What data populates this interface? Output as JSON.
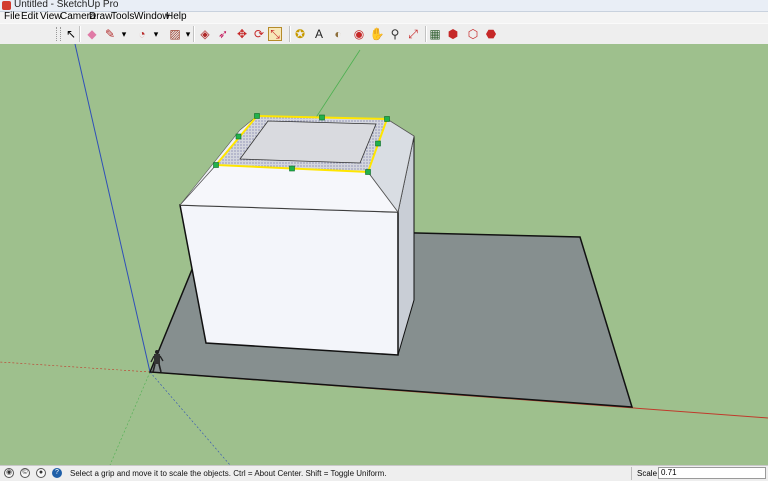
{
  "window": {
    "title": "Untitled - SketchUp Pro"
  },
  "menu": [
    "File",
    "Edit",
    "View",
    "Camera",
    "Draw",
    "Tools",
    "Window",
    "Help"
  ],
  "toolbar": {
    "tools": [
      {
        "name": "select-tool",
        "glyph": "↖",
        "color": "#000000"
      },
      {
        "name": "eraser-tool",
        "glyph": "◆",
        "color": "#e07aa6"
      },
      {
        "name": "pencil-tool",
        "glyph": "✎",
        "color": "#b12a2a"
      },
      {
        "name": "pencil-dropdown",
        "glyph": "▾",
        "color": "#000000"
      },
      {
        "name": "arc-tool",
        "glyph": "◔",
        "color": "#b82a2a"
      },
      {
        "name": "arc-dropdown",
        "glyph": "▾",
        "color": "#000000"
      },
      {
        "name": "rectangle-tool",
        "glyph": "▨",
        "color": "#9a3c2a"
      },
      {
        "name": "rectangle-dropdown",
        "glyph": "▾",
        "color": "#000000"
      },
      {
        "name": "push-pull-tool",
        "glyph": "◈",
        "color": "#b12a2a"
      },
      {
        "name": "follow-me-tool",
        "glyph": "➶",
        "color": "#c2185b"
      },
      {
        "name": "move-tool",
        "glyph": "✥",
        "color": "#c62828"
      },
      {
        "name": "rotate-tool",
        "glyph": "⟳",
        "color": "#c62828"
      },
      {
        "name": "scale-tool",
        "glyph": "⤡",
        "color": "#c62828",
        "active": true
      },
      {
        "name": "tape-measure-tool",
        "glyph": "✪",
        "color": "#c79a00"
      },
      {
        "name": "text-tool",
        "glyph": "A",
        "color": "#222222"
      },
      {
        "name": "paint-bucket-tool",
        "glyph": "◐",
        "color": "#8d6e3b"
      },
      {
        "name": "orbit-tool",
        "glyph": "◉",
        "color": "#c62828"
      },
      {
        "name": "pan-tool",
        "glyph": "✋",
        "color": "#6d4c41"
      },
      {
        "name": "zoom-tool",
        "glyph": "⚲",
        "color": "#333333"
      },
      {
        "name": "zoom-extents-tool",
        "glyph": "⤢",
        "color": "#c62828"
      },
      {
        "name": "components-tool",
        "glyph": "▦",
        "color": "#2e5d2e"
      },
      {
        "name": "3d-warehouse-tool",
        "glyph": "⬢",
        "color": "#c62828"
      },
      {
        "name": "share-model-tool",
        "glyph": "⬡",
        "color": "#c62828"
      },
      {
        "name": "extension-warehouse-tool",
        "glyph": "⬣",
        "color": "#c62828"
      }
    ]
  },
  "status": {
    "message": "Select a grip and move it to scale the objects. Ctrl = About Center. Shift = Toggle Uniform.",
    "scale_label": "Scale",
    "scale_value": "0.71"
  },
  "scene": {
    "sky_ground_color": "#9ec08d",
    "shadow_color": "#868f8f",
    "face_color": "#f3f5fa",
    "grip_color": "#22b14c",
    "selection_color": "#ffe600"
  }
}
